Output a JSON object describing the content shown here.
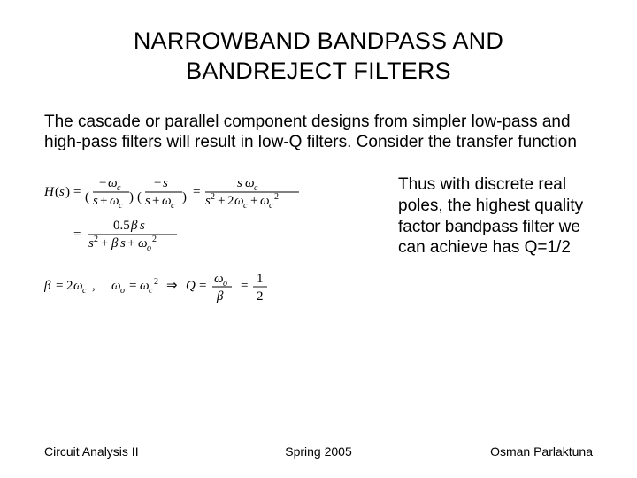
{
  "title_line1": "NARROWBAND BANDPASS AND",
  "title_line2": "BANDREJECT FILTERS",
  "paragraph": "The cascade or parallel component designs from simpler low-pass and high-pass filters will result in low-Q filters. Consider the transfer function",
  "side_paragraph": "Thus with discrete real poles, the highest quality factor bandpass filter we can achieve has Q=1/2",
  "equations": {
    "eq1_lhs": "H(s)",
    "eq1_factor1_num": "−ω_c",
    "eq1_factor1_den": "s + ω_c",
    "eq1_factor2_num": "−s",
    "eq1_factor2_den": "s + ω_c",
    "eq1_mid_num": "s ω_c",
    "eq1_mid_den": "s² + 2ω_c + ω_c²",
    "eq2_num": "0.5βs",
    "eq2_den": "s² + βs + ω_o²",
    "eq3_beta": "β = 2ω_c ,",
    "eq3_omega": "ω_o = ω_c²",
    "eq3_implies": "⇒ Q =",
    "eq3_Q_num": "ω_o",
    "eq3_Q_den": "β",
    "eq3_val": "= 1/2"
  },
  "footer": {
    "left": "Circuit Analysis II",
    "mid": "Spring 2005",
    "right": "Osman Parlaktuna"
  }
}
